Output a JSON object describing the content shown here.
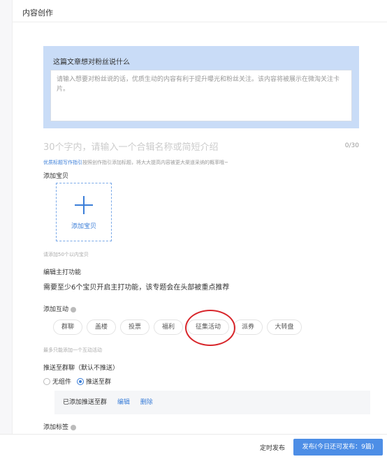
{
  "header": {
    "title": "内容创作"
  },
  "greeting": {
    "title": "这篇文章想对粉丝说什么",
    "placeholder": "请输入想要对粉丝说的话，优质生动的内容有利于提升曝光和粉丝关注。该内容将被展示在微淘关注卡片。"
  },
  "title_field": {
    "placeholder": "30个字内，请输入一个合辑名称或简短介绍",
    "count": "0/30"
  },
  "tip": {
    "link": "优质标题写作指引",
    "text": "按照创作指引添加标题，将大大提高内容被更大渠道采纳的概率哦~"
  },
  "products": {
    "label": "添加宝贝",
    "add_button": "添加宝贝",
    "hint": "请添加50个以内宝贝"
  },
  "feature": {
    "label": "编辑主打功能",
    "desc": "需要至少6个宝贝开启主打功能，该专题会在头部被重点推荐"
  },
  "interaction": {
    "label": "添加互动",
    "chips": [
      "群聊",
      "盖楼",
      "投票",
      "福利",
      "征集活动",
      "派券",
      "大转盘"
    ],
    "hint": "最多只能添加一个互动活动"
  },
  "push": {
    "label": "推送至群聊（默认不推送）",
    "options": [
      "无组件",
      "推送至群"
    ],
    "selected": "推送至群",
    "box_text": "已添加推送至群",
    "edit": "编辑",
    "delete": "删除"
  },
  "tags": {
    "label": "添加标签"
  },
  "footer": {
    "timed_publish": "定时发布",
    "publish": "发布(今日还可发布：9篇)"
  }
}
